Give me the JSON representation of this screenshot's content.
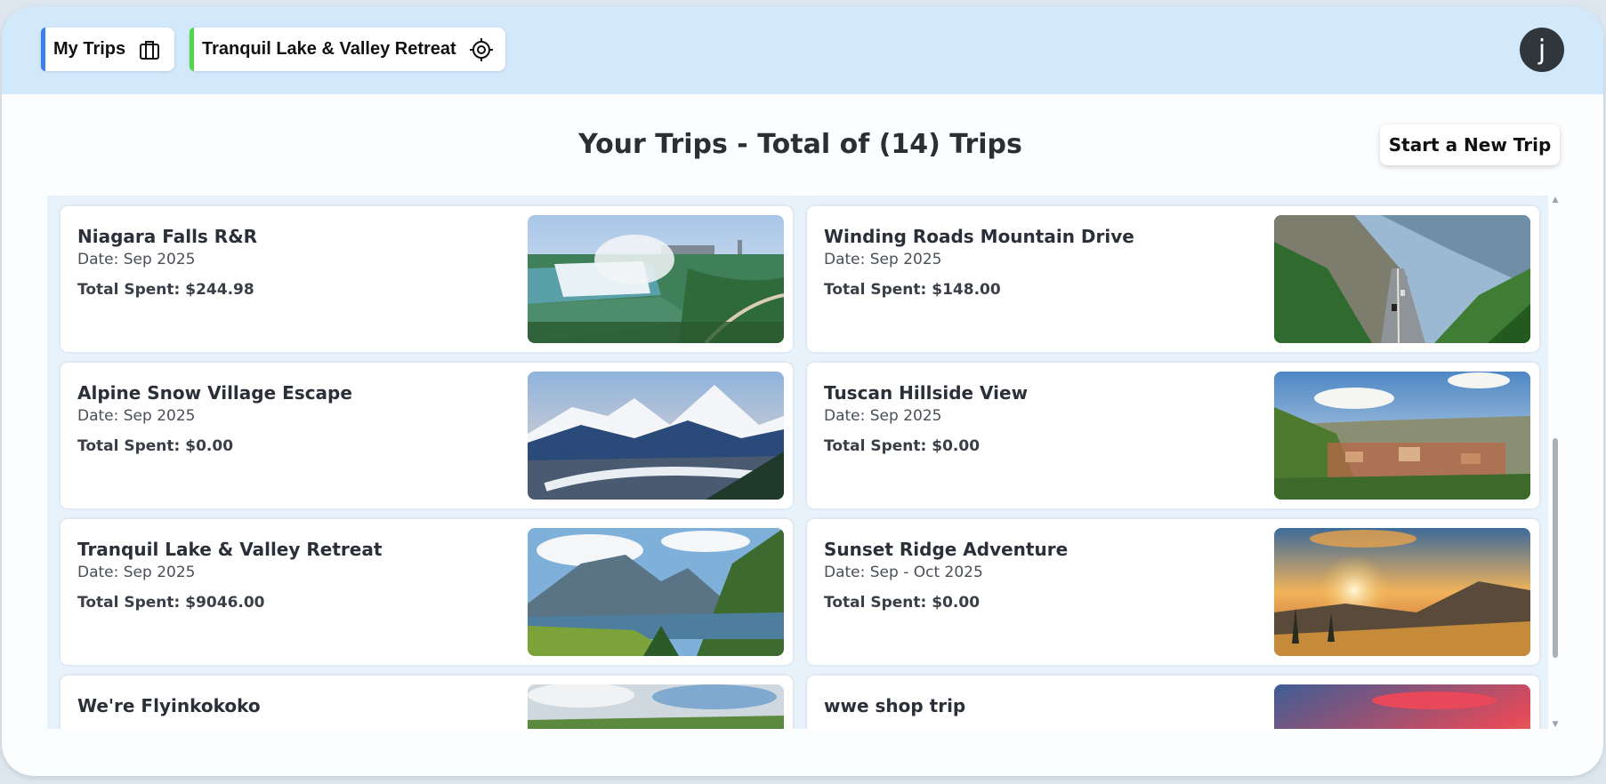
{
  "tabs": [
    {
      "label": "My Trips",
      "icon": "briefcase-icon",
      "accent": "#3d7ff0"
    },
    {
      "label": "Tranquil Lake & Valley Retreat",
      "icon": "target-icon",
      "accent": "#4ed84a"
    }
  ],
  "user": {
    "initial": "j"
  },
  "page": {
    "heading": "Your Trips - Total of (14) Trips",
    "new_trip_label": "Start a New Trip"
  },
  "trips": [
    {
      "title": "Niagara Falls R&R",
      "date": "Date: Sep 2025",
      "spent": "Total Spent: $244.98",
      "image": "waterfall-photo"
    },
    {
      "title": "Winding Roads Mountain Drive",
      "date": "Date: Sep 2025",
      "spent": "Total Spent: $148.00",
      "image": "mountain-road-photo"
    },
    {
      "title": "Alpine Snow Village Escape",
      "date": "Date: Sep 2025",
      "spent": "Total Spent: $0.00",
      "image": "alpine-village-photo"
    },
    {
      "title": "Tuscan Hillside View",
      "date": "Date: Sep 2025",
      "spent": "Total Spent: $0.00",
      "image": "tuscan-town-photo"
    },
    {
      "title": "Tranquil Lake & Valley Retreat",
      "date": "Date: Sep 2025",
      "spent": "Total Spent: $9046.00",
      "image": "lake-valley-photo"
    },
    {
      "title": "Sunset Ridge Adventure",
      "date": "Date: Sep - Oct 2025",
      "spent": "Total Spent: $0.00",
      "image": "sunset-ridge-photo"
    },
    {
      "title": "We're Flyinkokoko",
      "date": "",
      "spent": "",
      "image": "cloudy-hills-photo"
    },
    {
      "title": "wwe shop trip",
      "date": "",
      "spent": "",
      "image": "pink-sky-photo"
    }
  ]
}
